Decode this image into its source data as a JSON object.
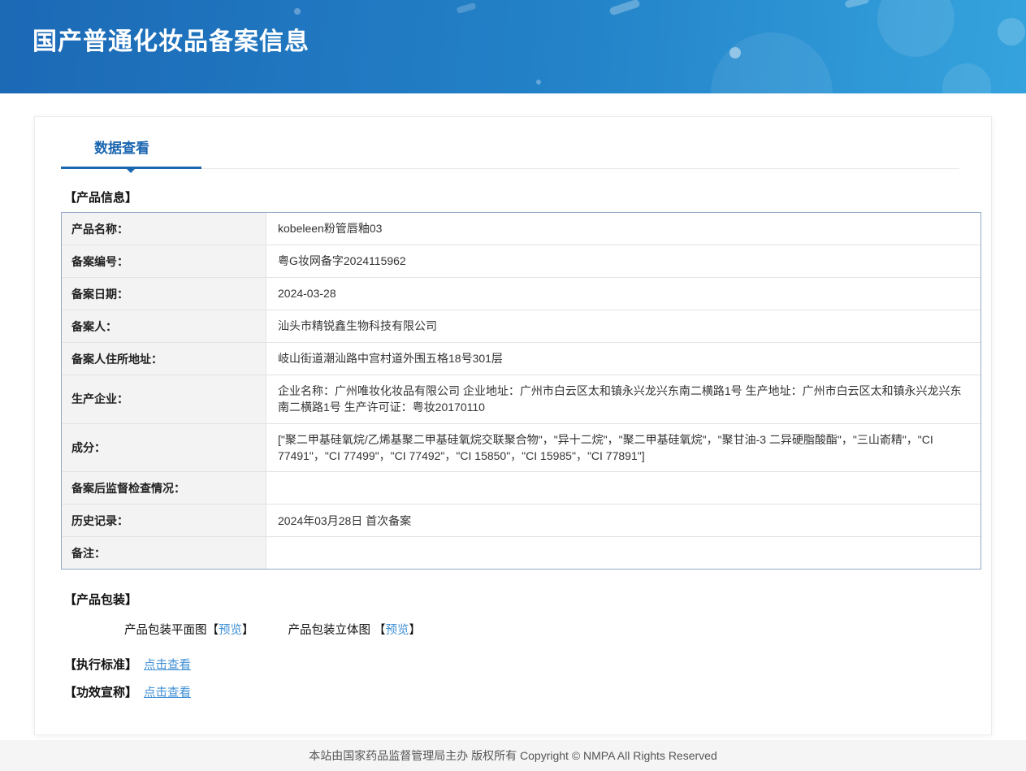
{
  "header": {
    "title": "国产普通化妆品备案信息"
  },
  "tab": {
    "label": "数据查看"
  },
  "sections": {
    "product_info_title": "【产品信息】",
    "packaging_title": "【产品包装】",
    "standard_title": "【执行标准】",
    "efficacy_title": "【功效宣称】"
  },
  "product_info": {
    "rows": [
      {
        "label": "产品名称：",
        "value": "kobeleen粉管唇釉03"
      },
      {
        "label": "备案编号：",
        "value": "粤G妆网备字2024115962"
      },
      {
        "label": "备案日期：",
        "value": "2024-03-28"
      },
      {
        "label": "备案人：",
        "value": "汕头市精锐鑫生物科技有限公司"
      },
      {
        "label": "备案人住所地址：",
        "value": "岐山街道潮汕路中宫村道外围五格18号301层"
      },
      {
        "label": "生产企业：",
        "value": "企业名称：广州唯妆化妆品有限公司 企业地址：广州市白云区太和镇永兴龙兴东南二横路1号 生产地址：广州市白云区太和镇永兴龙兴东南二横路1号 生产许可证：粤妆20170110"
      },
      {
        "label": "成分：",
        "value": "[\"聚二甲基硅氧烷/乙烯基聚二甲基硅氧烷交联聚合物\"，\"异十二烷\"，\"聚二甲基硅氧烷\"，\"聚甘油-3 二异硬脂酸酯\"，\"三山嵛精\"，\"CI 77491\"，\"CI 77499\"，\"CI 77492\"，\"CI 15850\"，\"CI 15985\"，\"CI 77891\"]"
      },
      {
        "label": "备案后监督检查情况：",
        "value": ""
      },
      {
        "label": "历史记录：",
        "value": "2024年03月28日 首次备案"
      },
      {
        "label": "备注：",
        "value": ""
      }
    ]
  },
  "packaging": {
    "flat_label": "产品包装平面图",
    "stereo_label": "产品包装立体图",
    "bracket_open": "【",
    "bracket_close": "】",
    "preview": "预览"
  },
  "links": {
    "view": "点击查看"
  },
  "footer": {
    "text": "本站由国家药品监督管理局主办 版权所有 Copyright © NMPA All Rights Reserved"
  }
}
